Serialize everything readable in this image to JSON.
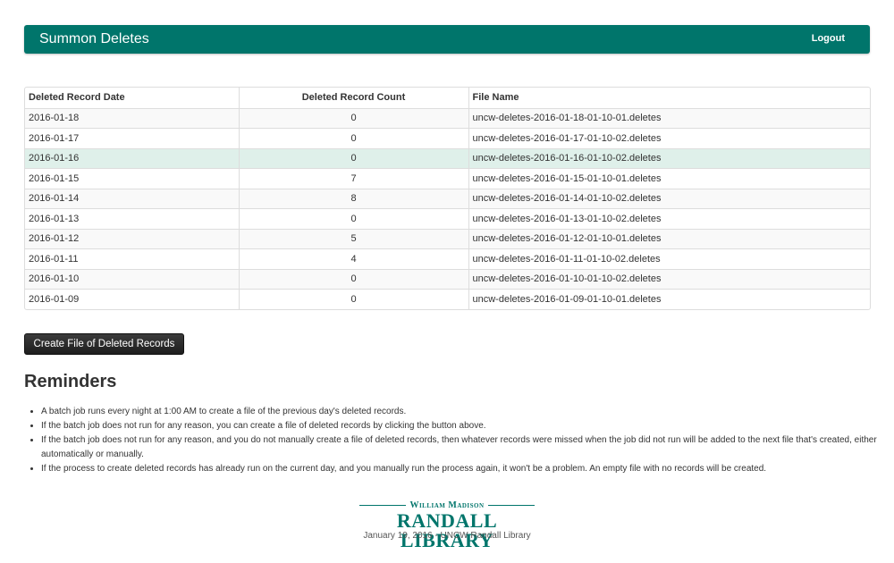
{
  "navbar": {
    "brand": "Summon Deletes",
    "logout_label": "Logout",
    "color": "#00756b"
  },
  "table": {
    "headers": [
      "Deleted Record Date",
      "Deleted Record Count",
      "File Name"
    ],
    "rows": [
      {
        "date": "2016-01-18",
        "count": "0",
        "file": "uncw-deletes-2016-01-18-01-10-01.deletes"
      },
      {
        "date": "2016-01-17",
        "count": "0",
        "file": "uncw-deletes-2016-01-17-01-10-02.deletes"
      },
      {
        "date": "2016-01-16",
        "count": "0",
        "file": "uncw-deletes-2016-01-16-01-10-02.deletes"
      },
      {
        "date": "2016-01-15",
        "count": "7",
        "file": "uncw-deletes-2016-01-15-01-10-01.deletes"
      },
      {
        "date": "2016-01-14",
        "count": "8",
        "file": "uncw-deletes-2016-01-14-01-10-02.deletes"
      },
      {
        "date": "2016-01-13",
        "count": "0",
        "file": "uncw-deletes-2016-01-13-01-10-02.deletes"
      },
      {
        "date": "2016-01-12",
        "count": "5",
        "file": "uncw-deletes-2016-01-12-01-10-01.deletes"
      },
      {
        "date": "2016-01-11",
        "count": "4",
        "file": "uncw-deletes-2016-01-11-01-10-02.deletes"
      },
      {
        "date": "2016-01-10",
        "count": "0",
        "file": "uncw-deletes-2016-01-10-01-10-02.deletes"
      },
      {
        "date": "2016-01-09",
        "count": "0",
        "file": "uncw-deletes-2016-01-09-01-10-01.deletes"
      }
    ]
  },
  "create_button_label": "Create File of Deleted Records",
  "reminders": {
    "title": "Reminders",
    "items": [
      "A batch job runs every night at 1:00 AM to create a file of the previous day's deleted records.",
      "If the batch job does not run for any reason, you can create a file of deleted records by clicking the button above.",
      "If the batch job does not run for any reason, and you do not manually create a file of deleted records, then whatever records were missed when the job did not run will be added to the next file that's created, either automatically or manually.",
      "If the process to create deleted records has already run on the current day, and you manually run the process again, it won't be a problem. An empty file with no records will be created."
    ]
  },
  "footer": {
    "logo_top": "William Madison",
    "logo_main": "RANDALL LIBRARY",
    "text": "January 19, 2016 - UNCW Randall Library"
  }
}
